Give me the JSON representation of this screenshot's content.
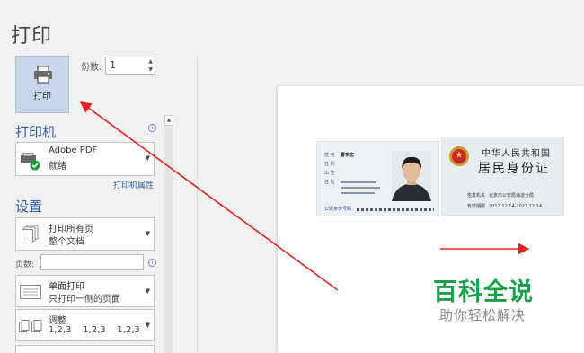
{
  "page": {
    "title": "打印"
  },
  "print_button": {
    "label": "打印"
  },
  "copies": {
    "label": "份数:",
    "value": "1"
  },
  "printer": {
    "section_title": "打印机",
    "name": "Adobe PDF",
    "status": "就绪",
    "properties_link": "打印机属性"
  },
  "settings": {
    "section_title": "设置",
    "range": {
      "main": "打印所有页",
      "sub": "整个文档"
    },
    "pages_label": "页数:",
    "sides": {
      "main": "单面打印",
      "sub": "只打印一侧的页面"
    },
    "collate": {
      "main": "调整",
      "sub": "1,2,3    1,2,3    1,2,3"
    }
  },
  "preview": {
    "id_back": {
      "title1": "中华人民共和国",
      "title2": "居民身份证",
      "field1_label": "签发机关",
      "field1_value": "北京市公安局海淀分局",
      "field2_label": "有效期限",
      "field2_value": "2012.12.14-2022.12.14"
    },
    "id_front": {
      "fields": [
        "姓 名",
        "性 别",
        "出 生",
        "住 址"
      ],
      "name_value": "曹东宏",
      "id_label": "公民身份号码"
    },
    "watermark": {
      "main": "百科全说",
      "sub": "助你轻松解决"
    }
  },
  "colors": {
    "accent": "#2f5aa0",
    "annotation_arrow": "#e02424",
    "watermark": "#1aa04a"
  }
}
